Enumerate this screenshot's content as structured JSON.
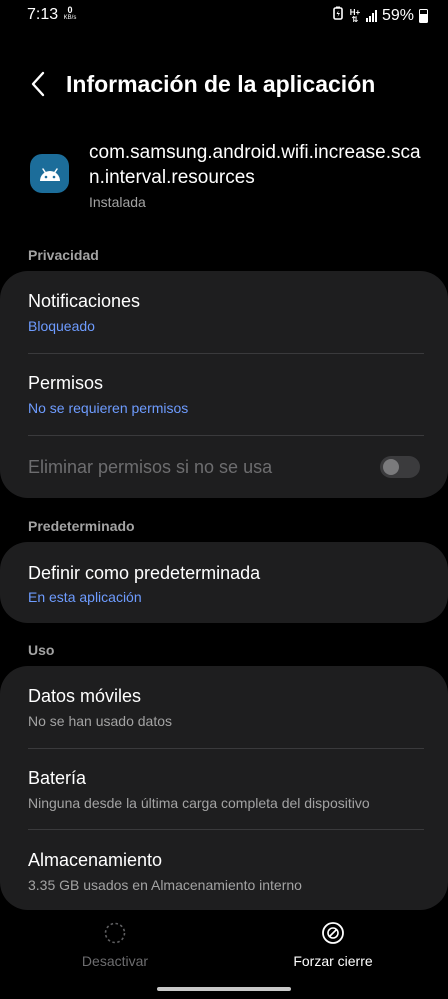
{
  "status_bar": {
    "time": "7:13",
    "data_speed": "0",
    "data_speed_unit": "KB/s",
    "network_type": "H+",
    "battery": "59%"
  },
  "header": {
    "title": "Información de la aplicación"
  },
  "app": {
    "package_name": "com.samsung.android.wifi.increase.scan.interval.resources",
    "status": "Instalada"
  },
  "sections": {
    "privacy": {
      "label": "Privacidad",
      "notifications": {
        "title": "Notificaciones",
        "value": "Bloqueado"
      },
      "permissions": {
        "title": "Permisos",
        "value": "No se requieren permisos"
      },
      "remove_permissions": {
        "title": "Eliminar permisos si no se usa",
        "enabled": false
      }
    },
    "default": {
      "label": "Predeterminado",
      "set_default": {
        "title": "Definir como predeterminada",
        "value": "En esta aplicación"
      }
    },
    "usage": {
      "label": "Uso",
      "mobile_data": {
        "title": "Datos móviles",
        "value": "No se han usado datos"
      },
      "battery": {
        "title": "Batería",
        "value": "Ninguna desde la última carga completa del dispositivo"
      },
      "storage": {
        "title": "Almacenamiento",
        "value": "3.35 GB usados en Almacenamiento interno"
      }
    }
  },
  "actions": {
    "disable": {
      "label": "Desactivar",
      "enabled": false
    },
    "force_stop": {
      "label": "Forzar cierre",
      "enabled": true
    }
  },
  "colors": {
    "background": "#000000",
    "card": "#1e1e1f",
    "accent": "#6e9cff",
    "secondary_text": "#a3a3a3",
    "disabled_text": "#6d6d6f"
  }
}
